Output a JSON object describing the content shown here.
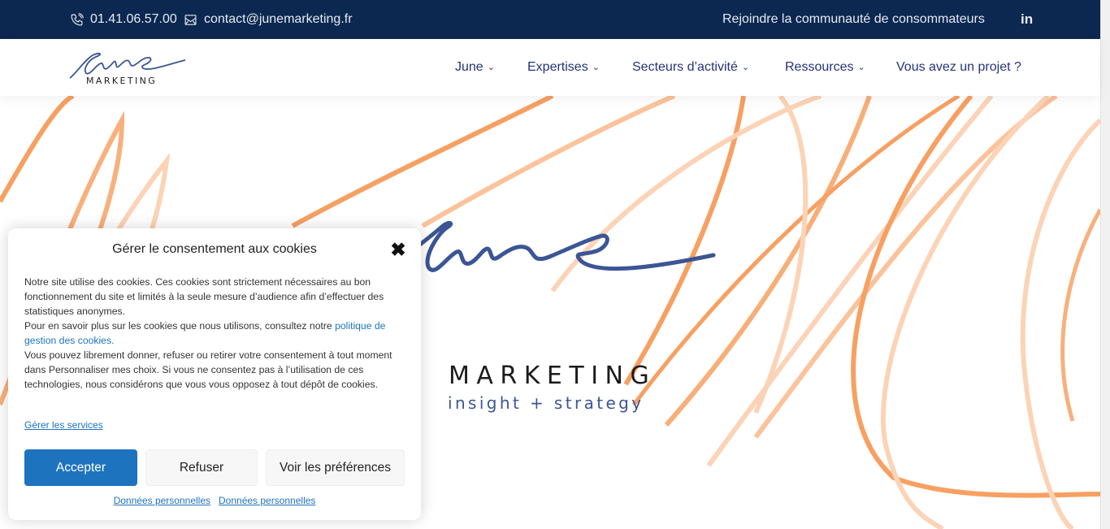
{
  "topbar": {
    "phone": "01.41.06.57.00",
    "email": "contact@junemarketing.fr",
    "community_link": "Rejoindre la communauté de consommateurs",
    "linkedin": "in"
  },
  "nav": {
    "items": [
      {
        "label": "June",
        "has_dropdown": true
      },
      {
        "label": "Expertises",
        "has_dropdown": true
      },
      {
        "label": "Secteurs d’activité",
        "has_dropdown": true
      },
      {
        "label": "Ressources",
        "has_dropdown": true
      },
      {
        "label": "Vous avez un projet ?",
        "has_dropdown": false
      }
    ]
  },
  "brand": {
    "small_logo_word": "MARKETING",
    "hero_wordmark": "MARKETING",
    "hero_tagline": "insight + strategy"
  },
  "cookie_modal": {
    "title": "Gérer le consentement aux cookies",
    "para1": "Notre site utilise des cookies. Ces cookies sont strictement nécessaires au bon fonctionnement du site et limités à la seule mesure d’audience afin d’effectuer des statistiques anonymes.",
    "para2_text": "Pour en savoir plus sur les cookies que nous utilisons, consultez notre",
    "para2_link": "politique de gestion des cookies.",
    "para3": "Vous pouvez librement donner, refuser ou retirer votre consentement à tout moment dans Personnaliser mes choix. Si vous ne consentez pas à l’utilisation de ces technologies, nous considérons que vous vous opposez à tout dépôt de cookies.",
    "manage_services": "Gérer les services",
    "accept": "Accepter",
    "refuse": "Refuser",
    "preferences": "Voir les préférences",
    "footer_links": [
      "Données personnelles",
      "Données personnelles"
    ]
  },
  "colors": {
    "topbar_bg": "#0c2850",
    "nav_text": "#25337a",
    "logo_blue": "#3b5595",
    "orange_stroke": "#f7a062",
    "orange_light": "#fcd3b6",
    "accept_bg": "#1e73be"
  },
  "icons": {
    "phone": "phone-icon",
    "email": "envelope-icon",
    "linkedin": "linkedin-icon",
    "close": "close-icon",
    "dropdown": "chevron-down-icon"
  }
}
